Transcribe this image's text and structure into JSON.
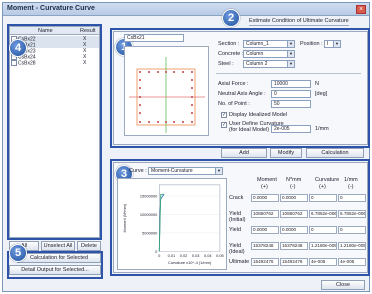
{
  "window": {
    "title": "Moment - Curvature Curve",
    "close": "×"
  },
  "estimate_tab": "Estimate Condition of Ultimate Curvature",
  "badges": [
    "1",
    "2",
    "3",
    "4",
    "5"
  ],
  "list": {
    "headers": [
      "Name",
      "Result"
    ],
    "rows": [
      {
        "name": "CsBx22",
        "result": "X"
      },
      {
        "name": "CsBx21",
        "result": "X"
      },
      {
        "name": "CsBx23",
        "result": "X"
      },
      {
        "name": "CsBx24",
        "result": "X"
      },
      {
        "name": "CsBx28",
        "result": "X"
      }
    ]
  },
  "buttons": {
    "select_all": "All",
    "unselect_all": "Unselect All",
    "delete": "Delete",
    "calc_selected": "Calculation for Selected",
    "detail_output": "Detail Output for Selected...",
    "add": "Add",
    "modify": "Modify",
    "calculation": "Calculation",
    "close": "Close"
  },
  "section_name": "CsBx21",
  "props": {
    "section_label": "Section :",
    "section_value": "Column_1",
    "position_label": "Position :",
    "position_value": "I",
    "concrete_label": "Concrete :",
    "concrete_value": "Column",
    "steel_label": "Steel :",
    "steel_value": "Column 2",
    "axial_label": "Axial Force :",
    "axial_value": "10000",
    "axial_unit": "N",
    "angle_label": "Neutral Axis Angle :",
    "angle_value": "0",
    "angle_unit": "[deg]",
    "points_label": "No. of Point :",
    "points_value": "50",
    "display_ideal": "Display Idealized Model",
    "user_curv_1": "User Define Curvature",
    "user_curv_2": "(for Ideal Model) :",
    "user_curv_value": "2e-005",
    "user_curv_unit": "1/mm"
  },
  "curve": {
    "label": "Curve :",
    "type": "Moment-Curvature",
    "y_axis_title": "Moment (N*mm)",
    "x_axis_title": "Curvature x10^-4 (1/mm)",
    "y_ticks": [
      "15000000",
      "10000000",
      "5000000",
      "0"
    ],
    "x_ticks": [
      "0",
      "0.01",
      "0.02",
      "0.03",
      "0.04",
      "0.05"
    ]
  },
  "results": {
    "col_headers": [
      "Moment",
      "N*mm",
      "Curvature",
      "1/mm"
    ],
    "units": [
      "(+)",
      "(-)",
      "(+)",
      "(-)"
    ],
    "rows": [
      {
        "label": "Crack",
        "label2": "",
        "vals": [
          "0.0000",
          "0.0000",
          "0",
          "0"
        ]
      },
      {
        "label": "Yield",
        "label2": "(Initial)",
        "vals": [
          "10860762",
          "10860762",
          "6.7852e-006",
          "6.7852e-006"
        ]
      },
      {
        "label": "Yield",
        "label2": "",
        "vals": [
          "0.0000",
          "0.0000",
          "0",
          "0"
        ]
      },
      {
        "label": "Yield",
        "label2": "(Ideal)",
        "vals": [
          "15378248",
          "15378248",
          "1.2180e-005",
          "1.2180e-005"
        ]
      },
      {
        "label": "Ultimate",
        "label2": "",
        "vals": [
          "15492476",
          "15492476",
          "4e-005",
          "4e-005"
        ]
      }
    ]
  },
  "chart_data": {
    "type": "line",
    "title": "",
    "xlabel": "Curvature x10^-4 (1/mm)",
    "ylabel": "Moment (N*mm)",
    "xlim": [
      0,
      0.05
    ],
    "ylim": [
      0,
      18000000
    ],
    "series": [
      {
        "values": [
          [
            0,
            0
          ],
          [
            0.0007,
            10860762
          ],
          [
            0.0012,
            14200000
          ],
          [
            0.004,
            15492476
          ]
        ],
        "color": "#3a6fc9"
      },
      {
        "values": [
          [
            0,
            0
          ],
          [
            0.0012,
            15378248
          ],
          [
            0.004,
            15492476
          ]
        ],
        "color": "#3aa57b"
      }
    ]
  },
  "colors": {
    "accent": "#2d54a8",
    "badge": "#1f4f9e"
  }
}
